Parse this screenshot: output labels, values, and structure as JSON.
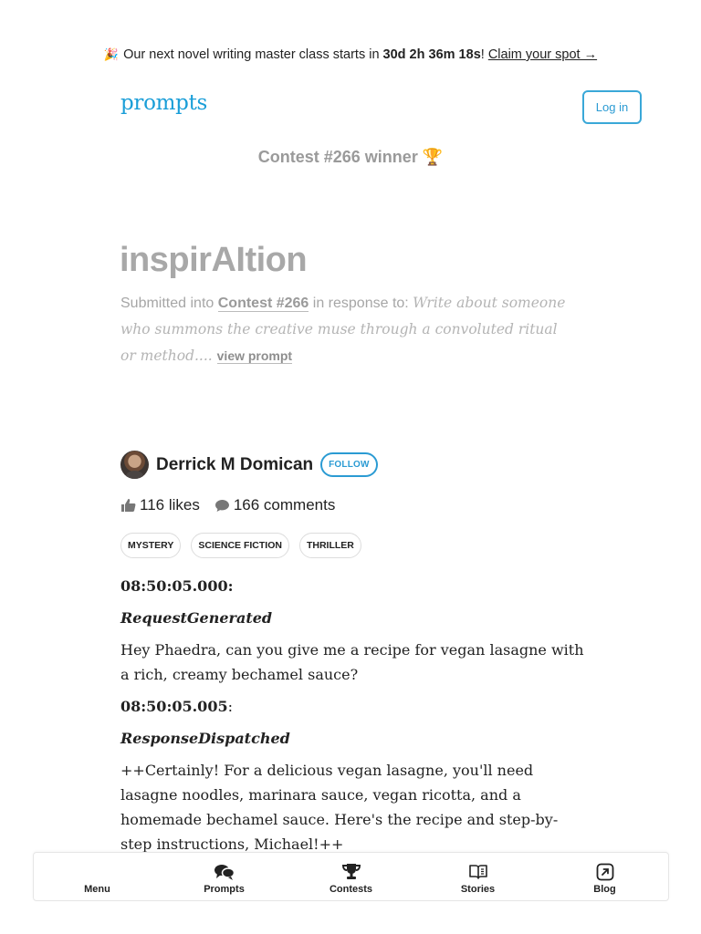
{
  "banner": {
    "prefix": "Our next novel writing master class starts in ",
    "countdown": "30d 2h 36m 18s",
    "bang": "! ",
    "cta": "Claim your spot →",
    "icon": "party-popper-icon"
  },
  "header": {
    "logo": "prompts",
    "login_label": "Log in"
  },
  "winner_label": "Contest #266 winner 🏆",
  "story": {
    "title": "inspirAItion",
    "submitted_prefix": "Submitted into ",
    "contest_link": "Contest #266",
    "response_to": " in response to: ",
    "prompt_text": "Write about someone who summons the creative muse through a convoluted ritual or method.... ",
    "view_prompt": "view prompt"
  },
  "author": {
    "name": "Derrick M Domican",
    "follow_label": "FOLLOW"
  },
  "stats": {
    "likes": "116 likes",
    "comments": "166 comments"
  },
  "tags": [
    "MYSTERY",
    "SCIENCE FICTION",
    "THRILLER"
  ],
  "body": {
    "ts1": "08:50:05.000:",
    "event1": "RequestGenerated",
    "para1": "Hey Phaedra, can you give me a recipe for vegan lasagne with a rich, creamy bechamel sauce?",
    "ts2": "08:50:05.005",
    "ts2_colon": ":",
    "event2": "ResponseDispatched",
    "para2": "++Certainly! For a delicious vegan lasagne, you'll need lasagne noodles, marinara sauce, vegan ricotta, and a homemade bechamel sauce. Here's the recipe and step-by-step instructions, Michael!++"
  },
  "nav": {
    "items": [
      {
        "label": "Menu",
        "icon": ""
      },
      {
        "label": "Prompts",
        "icon": "speech-bubbles-icon"
      },
      {
        "label": "Contests",
        "icon": "trophy-icon"
      },
      {
        "label": "Stories",
        "icon": "open-book-icon"
      },
      {
        "label": "Blog",
        "icon": "external-arrow-icon"
      }
    ]
  },
  "colors": {
    "accent": "#2b9bd3",
    "logo": "#1a9ed8",
    "muted": "#a8a8a8"
  }
}
